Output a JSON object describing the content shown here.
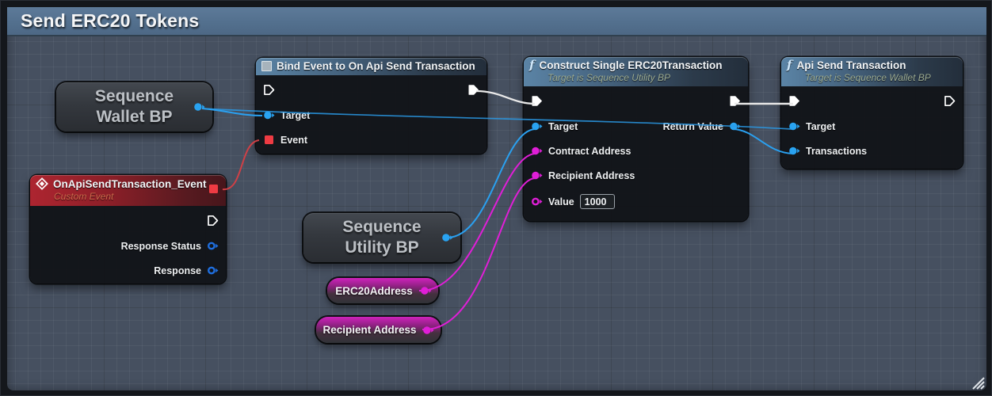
{
  "window": {
    "title": "Send ERC20 Tokens"
  },
  "nodes": {
    "sequence_wallet_bp": {
      "line1": "Sequence",
      "line2": "Wallet BP"
    },
    "bind_event": {
      "title": "Bind Event to On Api Send Transaction",
      "target_label": "Target",
      "event_label": "Event"
    },
    "on_api_send_transaction_event": {
      "title": "OnApiSendTransaction_Event",
      "subtitle": "Custom Event",
      "response_status_label": "Response Status",
      "response_label": "Response"
    },
    "sequence_utility_bp": {
      "line1": "Sequence",
      "line2": "Utility BP"
    },
    "erc20_address": {
      "title": "ERC20Address"
    },
    "recipient_address": {
      "title": "Recipient Address"
    },
    "construct_single_erc20transaction": {
      "title": "Construct Single ERC20Transaction",
      "subtitle": "Target is Sequence Utility BP",
      "target_label": "Target",
      "contract_address_label": "Contract Address",
      "recipient_address_label": "Recipient Address",
      "value_label": "Value",
      "value_input": "1000",
      "return_value_label": "Return Value"
    },
    "api_send_transaction": {
      "title": "Api Send Transaction",
      "subtitle": "Target is Sequence Wallet BP",
      "target_label": "Target",
      "transactions_label": "Transactions"
    }
  },
  "colors": {
    "titlebar": "#54718f",
    "canvas_background": "#465060",
    "function_header_blue": "#4d7ba0",
    "event_header_red": "#a52630",
    "exec_wire_white": "#e9e9e9",
    "object_pin_blue": "#29a3f1",
    "struct_pin_magenta": "#e01ed7",
    "delegate_pin_red": "#ee3b43",
    "event_wire_red": "#cf4046"
  }
}
